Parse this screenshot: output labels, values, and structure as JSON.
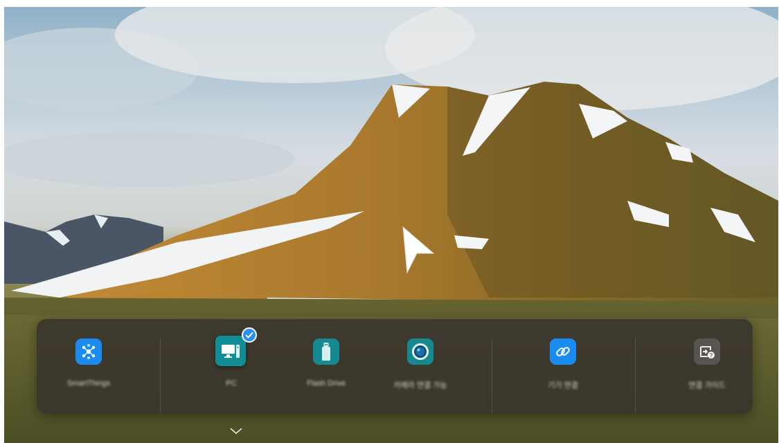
{
  "background": {
    "scene": "mountain-landscape",
    "colors": {
      "sky_top": "#8fb0c8",
      "cloud": "#e7eaec",
      "mountain_lit": "#b07a2a",
      "mountain_shadow": "#5a4a25",
      "snow": "#f4f6f8",
      "grass": "#6b6a33"
    }
  },
  "dock": {
    "items": [
      {
        "id": "smartthings",
        "label": "SmartThings",
        "icon": "smartthings-icon",
        "color": "#1a8cf0"
      },
      {
        "id": "pc",
        "label": "PC",
        "icon": "pc-monitor-icon",
        "color": "#0f8f95",
        "selected": true
      },
      {
        "id": "flash-drive",
        "label": "Flash Drive",
        "icon": "usb-drive-icon",
        "color": "#16888f"
      },
      {
        "id": "camera",
        "label": "카메라 연결 가능",
        "icon": "camera-lens-icon",
        "color": "#16888f"
      },
      {
        "id": "connection-guide",
        "label": "기기 연결",
        "icon": "link-icon",
        "color": "#1a8cf0"
      },
      {
        "id": "source-guide",
        "label": "연결 가이드",
        "icon": "source-help-icon",
        "color": "#5a5450"
      }
    ],
    "selected_badge_icon": "checkmark-icon"
  },
  "expand_icon": "chevron-down-icon"
}
